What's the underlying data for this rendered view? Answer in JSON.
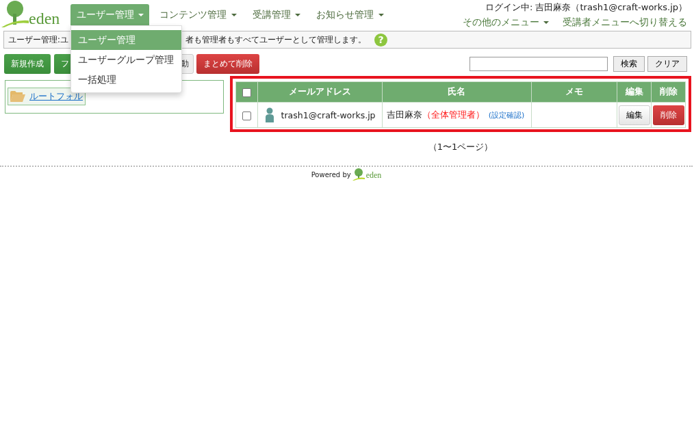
{
  "nav": {
    "items": [
      {
        "label": "ユーザー管理",
        "selected": true
      },
      {
        "label": "コンテンツ管理",
        "selected": false
      },
      {
        "label": "受講管理",
        "selected": false
      },
      {
        "label": "お知らせ管理",
        "selected": false
      }
    ],
    "login": "ログイン中: 吉田麻奈（trash1@craft-works.jp）",
    "other_menu": "その他のメニュー",
    "switch_link": "受講者メニューへ切り替える"
  },
  "dropdown": {
    "items": [
      {
        "label": "ユーザー管理",
        "selected": true
      },
      {
        "label": "ユーザーグループ管理",
        "selected": false
      },
      {
        "label": "一括処理",
        "selected": false
      }
    ]
  },
  "info_bar": {
    "text_before": "ユーザー管理:ユ",
    "text_after": "者も管理者もすべてユーザーとして管理します。",
    "help": "?"
  },
  "toolbar": {
    "buttons": [
      {
        "label": "新規作成",
        "kind": "primary"
      },
      {
        "label": "フ",
        "kind": "primary"
      },
      {
        "label": "動",
        "kind": "default"
      },
      {
        "label": "まとめて削除",
        "kind": "danger"
      }
    ],
    "search_button": "検索",
    "clear_button": "クリア"
  },
  "folder": {
    "label": "ルートフォル"
  },
  "table": {
    "all_checked": false,
    "columns": [
      "メールアドレス",
      "氏名",
      "メモ",
      "編集",
      "削除"
    ],
    "rows": [
      {
        "checked": false,
        "email": "trash1@craft-works.jp",
        "name": "吉田麻奈",
        "role": "（全体管理者）",
        "settings_link": "(設定確認)",
        "memo": "",
        "edit": "編集",
        "delete": "削除"
      }
    ]
  },
  "pagination": "（1〜1ページ）",
  "footer": {
    "powered_by": "Powered by",
    "logo": "eden"
  },
  "logo": "eden"
}
